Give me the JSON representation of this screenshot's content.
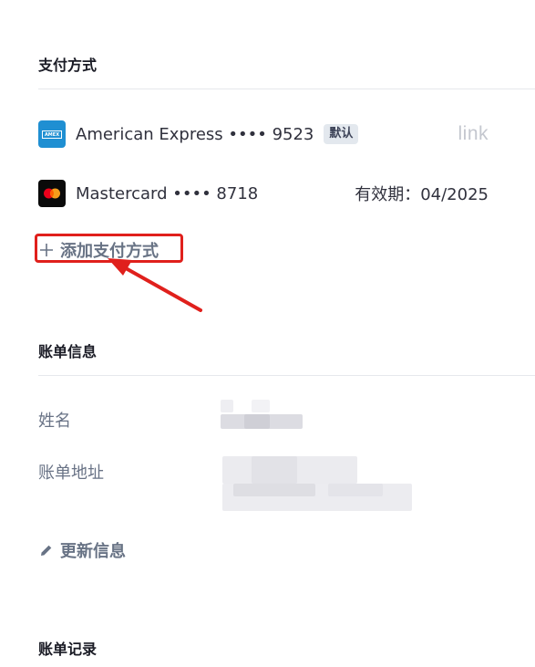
{
  "payment_methods": {
    "title": "支付方式",
    "cards": [
      {
        "icon": "amex-card-icon",
        "icon_text": "AMEX",
        "description": "American Express •••• 9523",
        "badge": "默认",
        "right_logo": "link"
      },
      {
        "icon": "mastercard-icon",
        "description": "Mastercard •••• 8718",
        "expiry": "有效期：04/2025"
      }
    ],
    "add_label": "添加支付方式"
  },
  "billing_info": {
    "title": "账单信息",
    "fields": [
      {
        "label": "姓名"
      },
      {
        "label": "账单地址"
      }
    ],
    "update_label": "更新信息"
  },
  "billing_history": {
    "title": "账单记录"
  },
  "colors": {
    "accent_link": "#687385",
    "annotation_red": "#e0201c",
    "amex_blue": "#1f8fd2"
  }
}
